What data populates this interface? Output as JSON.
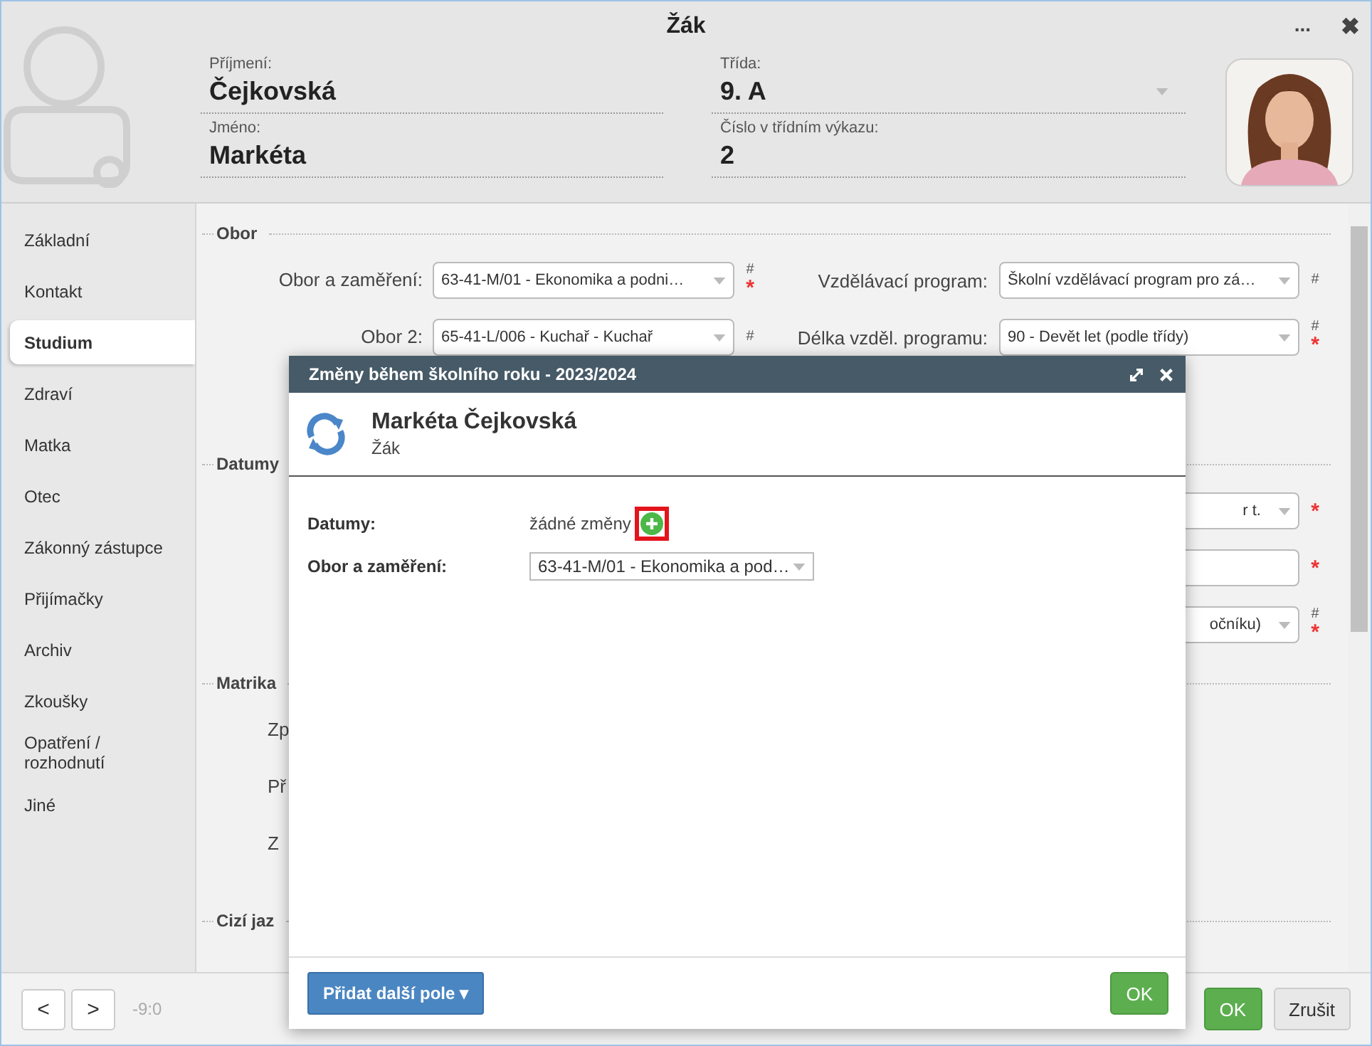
{
  "window": {
    "title": "Žák",
    "more": "...",
    "close": "✖"
  },
  "header": {
    "fields": [
      {
        "label": "Příjmení:",
        "value": "Čejkovská",
        "kind": "text"
      },
      {
        "label": "Jméno:",
        "value": "Markéta",
        "kind": "text"
      },
      {
        "label": "Třída:",
        "value": "9. A",
        "kind": "select"
      },
      {
        "label": "Číslo v třídním výkazu:",
        "value": "2",
        "kind": "text"
      }
    ]
  },
  "sidebar": {
    "items": [
      {
        "label": "Základní",
        "selected": false
      },
      {
        "label": "Kontakt",
        "selected": false
      },
      {
        "label": "Studium",
        "selected": true
      },
      {
        "label": "Zdraví",
        "selected": false
      },
      {
        "label": "Matka",
        "selected": false
      },
      {
        "label": "Otec",
        "selected": false
      },
      {
        "label": "Zákonný zástupce",
        "selected": false
      },
      {
        "label": "Přijímačky",
        "selected": false
      },
      {
        "label": "Archiv",
        "selected": false
      },
      {
        "label": "Zkoušky",
        "selected": false
      },
      {
        "label": "Opatření / rozhodnutí",
        "selected": false
      },
      {
        "label": "Jiné",
        "selected": false
      }
    ]
  },
  "form": {
    "sections": [
      {
        "title": "Obor",
        "rows": [
          {
            "left": {
              "label": "Obor a zaměření:",
              "value": "63-41-M/01 - Ekonomika a podni…",
              "hash": "#",
              "required": "*"
            },
            "right": {
              "label": "Vzdělávací program:",
              "value": "Školní vzdělávací program pro zá…",
              "hash": "#"
            }
          },
          {
            "left": {
              "label": "Obor 2:",
              "value": "65-41-L/006 - Kuchař - Kuchař",
              "hash": "#"
            },
            "right": {
              "label": "Délka vzděl. programu:",
              "value": "90 - Devět let (podle třídy)",
              "hash": "#",
              "required": "*"
            }
          }
        ]
      },
      {
        "title": "Datumy",
        "rows": [
          {
            "right": {
              "value_tail": "r t.",
              "required": "*"
            }
          },
          {
            "right": {
              "required": "*"
            }
          },
          {
            "right": {
              "value_tail": "očníku)",
              "hash": "#",
              "required": "*"
            }
          }
        ]
      },
      {
        "title": "Matrika",
        "rows": [
          {
            "left": {
              "label_fragment": "Zp"
            }
          },
          {
            "left": {
              "label_fragment": "Př"
            }
          },
          {
            "left": {
              "label_fragment": "Z"
            }
          }
        ]
      },
      {
        "title": "Cizí jaz"
      }
    ]
  },
  "footer": {
    "prev": "<",
    "next": ">",
    "position": "-9:0",
    "ok": "OK",
    "cancel": "Zrušit"
  },
  "dialog": {
    "title": "Změny během školního roku - 2023/2024",
    "name": "Markéta Čejkovská",
    "role": "Žák",
    "rows": [
      {
        "label": "Datumy:",
        "kind": "text",
        "value": "žádné změny",
        "add_highlighted": true
      },
      {
        "label": "Obor a zaměření:",
        "kind": "select",
        "value": "63-41-M/01 - Ekonomika a pod…"
      }
    ],
    "add_field": "Přidat další pole ▾",
    "ok": "OK"
  }
}
